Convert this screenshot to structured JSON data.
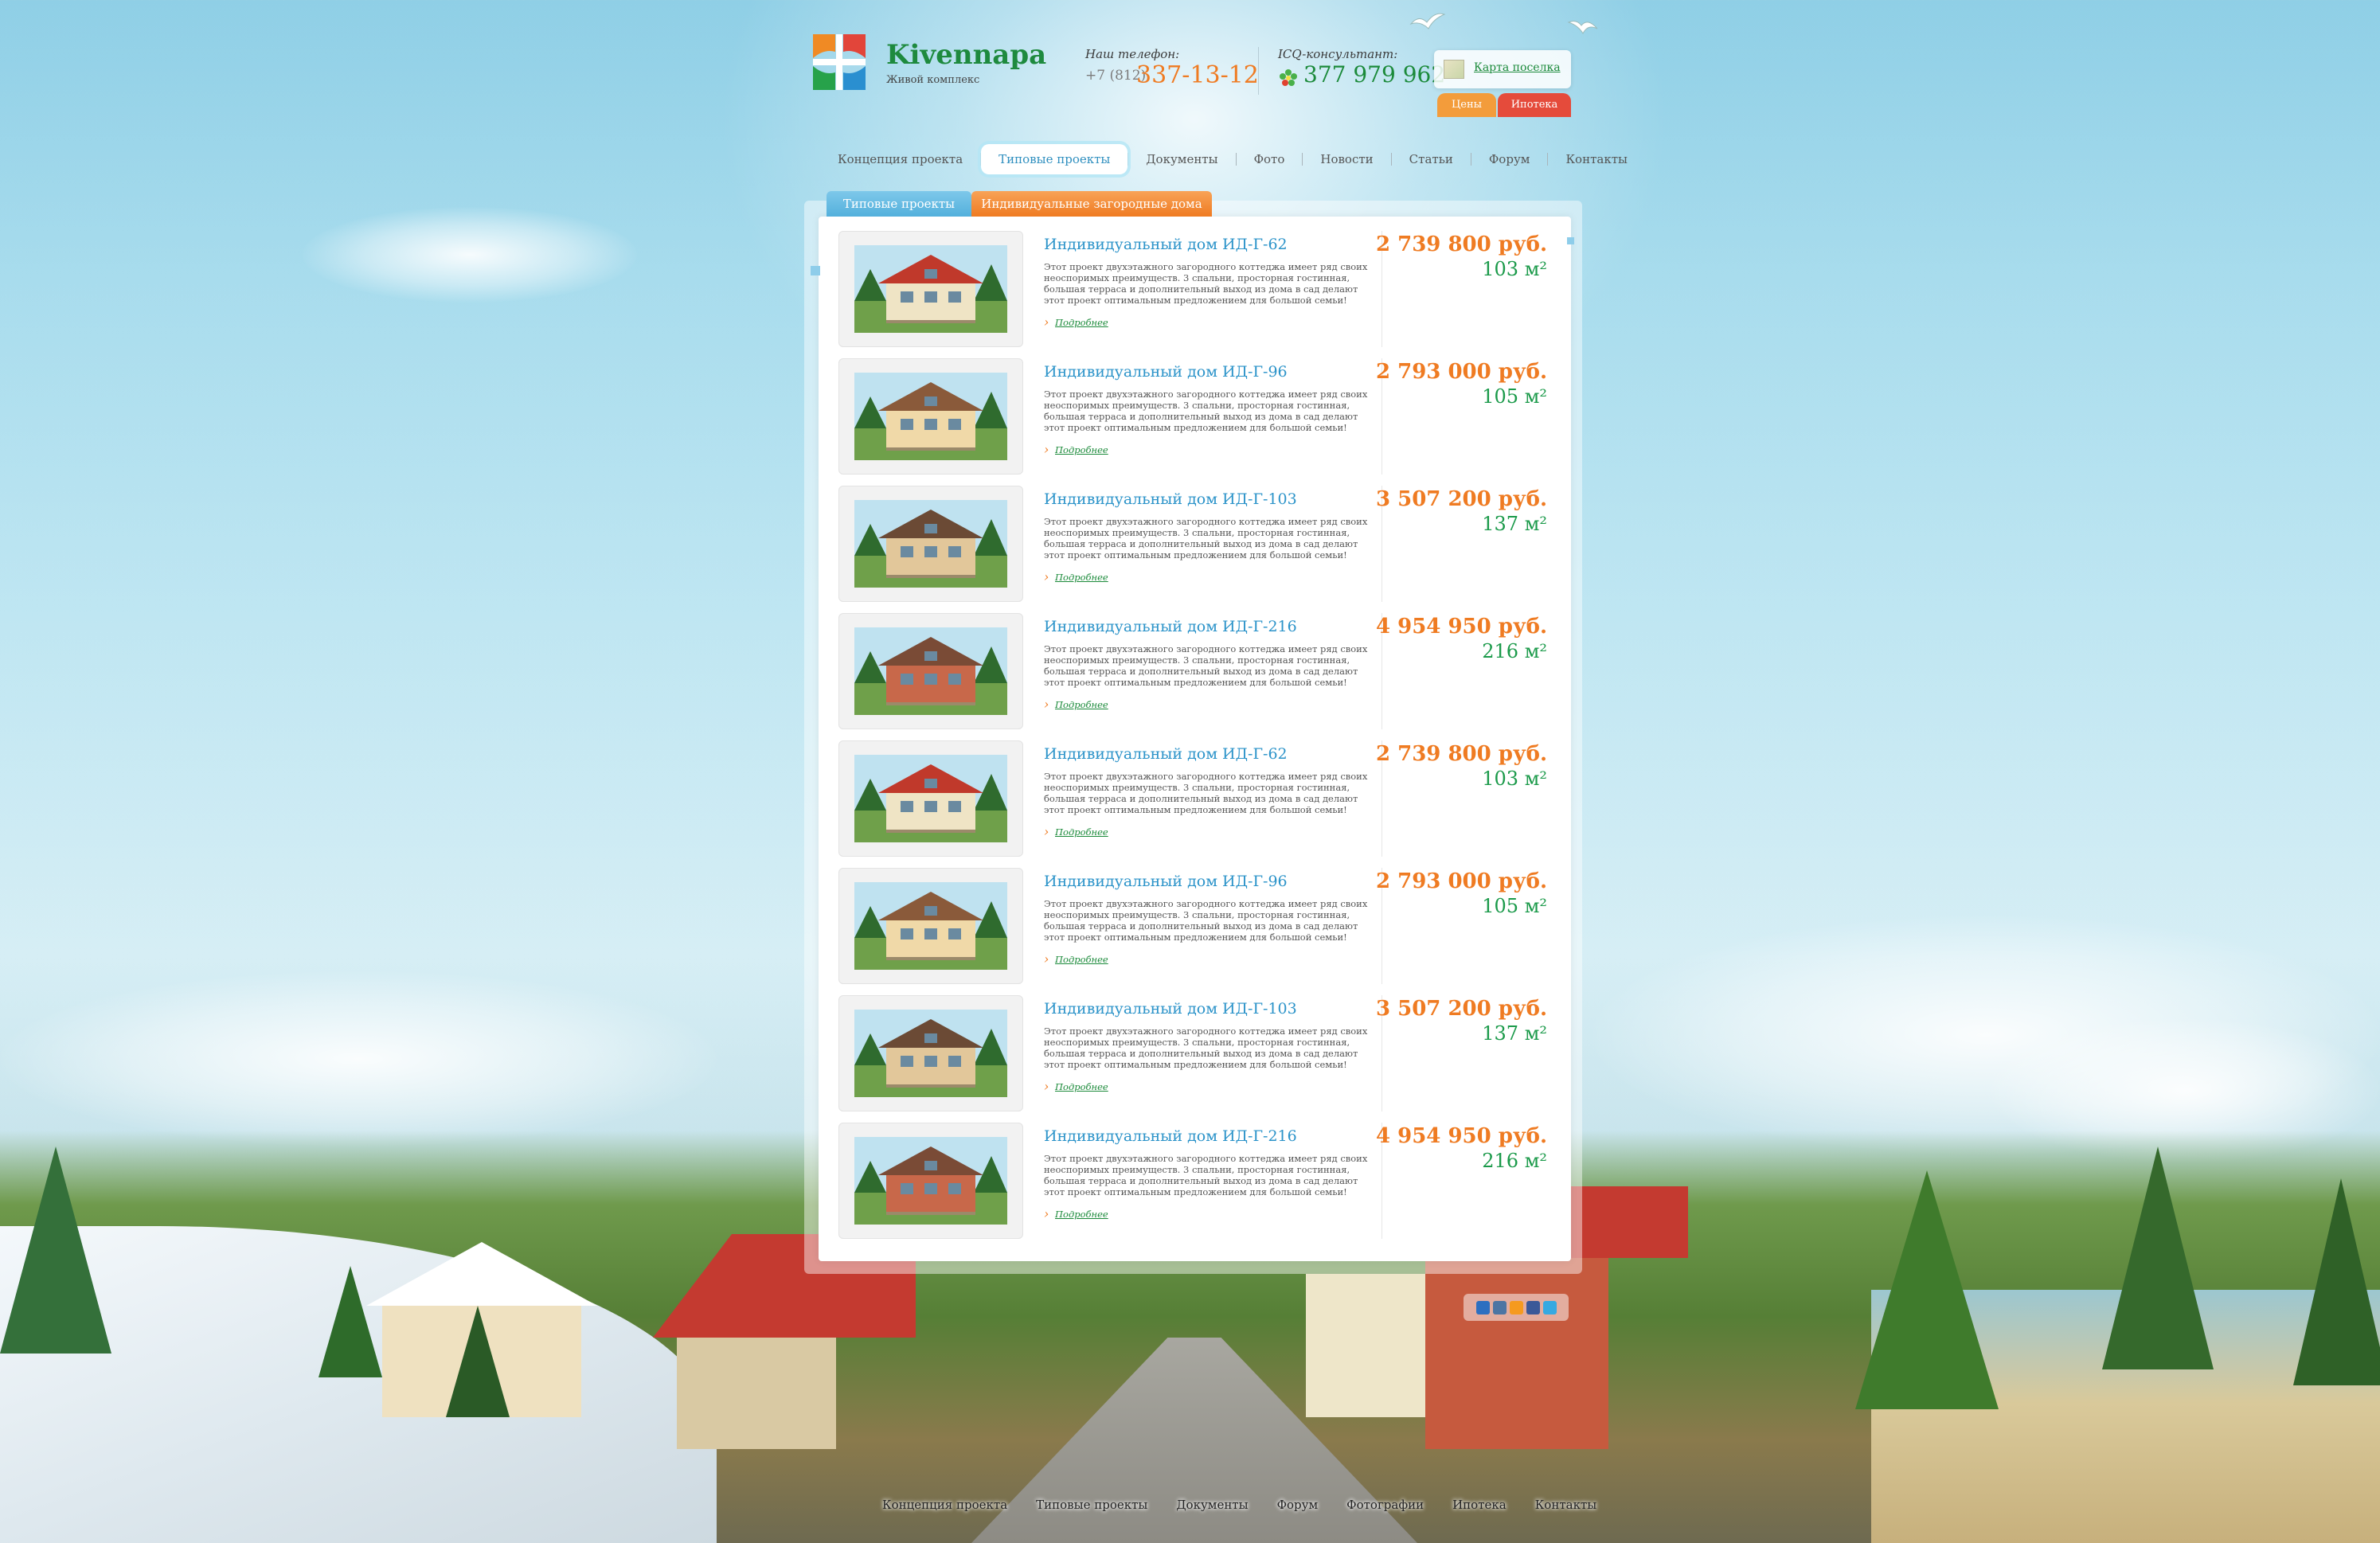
{
  "header": {
    "brand": "Kivennapa",
    "tagline": "Живой комплекс",
    "phone_label": "Наш телефон:",
    "phone_prefix": "+7 (812)",
    "phone_number": "337-13-12",
    "icq_label": "ICQ-консультант:",
    "icq_number": "377 979 962",
    "map_link": "Карта поселка",
    "btn_prices": "Цены",
    "btn_mortgage": "Ипотека"
  },
  "nav": {
    "items": [
      "Концепция проекта",
      "Типовые проекты",
      "Документы",
      "Фото",
      "Новости",
      "Статьи",
      "Форум",
      "Контакты"
    ],
    "active": "Типовые проекты"
  },
  "subtabs": {
    "tab1": "Типовые проекты",
    "tab2": "Индивидуальные загородные дома"
  },
  "listings": [
    {
      "title": "Индивидуальный дом ИД-Г-62",
      "desc": "Этот проект двухэтажного загородного коттеджа имеет ряд своих неоспоримых преимуществ. 3 спальни, просторная гостинная, большая терраса и дополнительный выход из дома в сад делают этот проект оптимальным предложением для большой семьи!",
      "more": "Подробнее",
      "price": "2 739 800 руб.",
      "area": "103 м²",
      "roof": "#c0392b",
      "wall": "#efe4c5"
    },
    {
      "title": "Индивидуальный дом ИД-Г-96",
      "desc": "Этот проект двухэтажного загородного коттеджа имеет ряд своих неоспоримых преимуществ. 3 спальни, просторная гостинная, большая терраса и дополнительный выход из дома в сад делают этот проект оптимальным предложением для большой семьи!",
      "more": "Подробнее",
      "price": "2 793 000 руб.",
      "area": "105 м²",
      "roof": "#8a5a3a",
      "wall": "#f0d9a8"
    },
    {
      "title": "Индивидуальный дом ИД-Г-103",
      "desc": "Этот проект двухэтажного загородного коттеджа имеет ряд своих неоспоримых преимуществ. 3 спальни, просторная гостинная, большая терраса и дополнительный выход из дома в сад делают этот проект оптимальным предложением для большой семьи!",
      "more": "Подробнее",
      "price": "3 507 200 руб.",
      "area": "137 м²",
      "roof": "#6b4a35",
      "wall": "#e2c79a"
    },
    {
      "title": "Индивидуальный дом ИД-Г-216",
      "desc": "Этот проект двухэтажного загородного коттеджа имеет ряд своих неоспоримых преимуществ. 3 спальни, просторная гостинная, большая терраса и дополнительный выход из дома в сад делают этот проект оптимальным предложением для большой семьи!",
      "more": "Подробнее",
      "price": "4 954 950 руб.",
      "area": "216 м²",
      "roof": "#7a4b36",
      "wall": "#c8684a"
    },
    {
      "title": "Индивидуальный дом ИД-Г-62",
      "desc": "Этот проект двухэтажного загородного коттеджа имеет ряд своих неоспоримых преимуществ. 3 спальни, просторная гостинная, большая терраса и дополнительный выход из дома в сад делают этот проект оптимальным предложением для большой семьи!",
      "more": "Подробнее",
      "price": "2 739 800 руб.",
      "area": "103 м²",
      "roof": "#c0392b",
      "wall": "#efe4c5"
    },
    {
      "title": "Индивидуальный дом ИД-Г-96",
      "desc": "Этот проект двухэтажного загородного коттеджа имеет ряд своих неоспоримых преимуществ. 3 спальни, просторная гостинная, большая терраса и дополнительный выход из дома в сад делают этот проект оптимальным предложением для большой семьи!",
      "more": "Подробнее",
      "price": "2 793 000 руб.",
      "area": "105 м²",
      "roof": "#8a5a3a",
      "wall": "#f0d9a8"
    },
    {
      "title": "Индивидуальный дом ИД-Г-103",
      "desc": "Этот проект двухэтажного загородного коттеджа имеет ряд своих неоспоримых преимуществ. 3 спальни, просторная гостинная, большая терраса и дополнительный выход из дома в сад делают этот проект оптимальным предложением для большой семьи!",
      "more": "Подробнее",
      "price": "3 507 200 руб.",
      "area": "137 м²",
      "roof": "#6b4a35",
      "wall": "#e2c79a"
    },
    {
      "title": "Индивидуальный дом ИД-Г-216",
      "desc": "Этот проект двухэтажного загородного коттеджа имеет ряд своих неоспоримых преимуществ. 3 спальни, просторная гостинная, большая терраса и дополнительный выход из дома в сад делают этот проект оптимальным предложением для большой семьи!",
      "more": "Подробнее",
      "price": "4 954 950 руб.",
      "area": "216 м²",
      "roof": "#7a4b36",
      "wall": "#c8684a"
    }
  ],
  "footer": {
    "items": [
      "Концепция проекта",
      "Типовые проекты",
      "Документы",
      "Форум",
      "Фотографии",
      "Ипотека",
      "Контакты"
    ]
  },
  "colors": {
    "accent_orange": "#ef7b22",
    "accent_green": "#1b8a3a",
    "accent_blue": "#2b93c9",
    "mortgage_red": "#e54b3b"
  }
}
